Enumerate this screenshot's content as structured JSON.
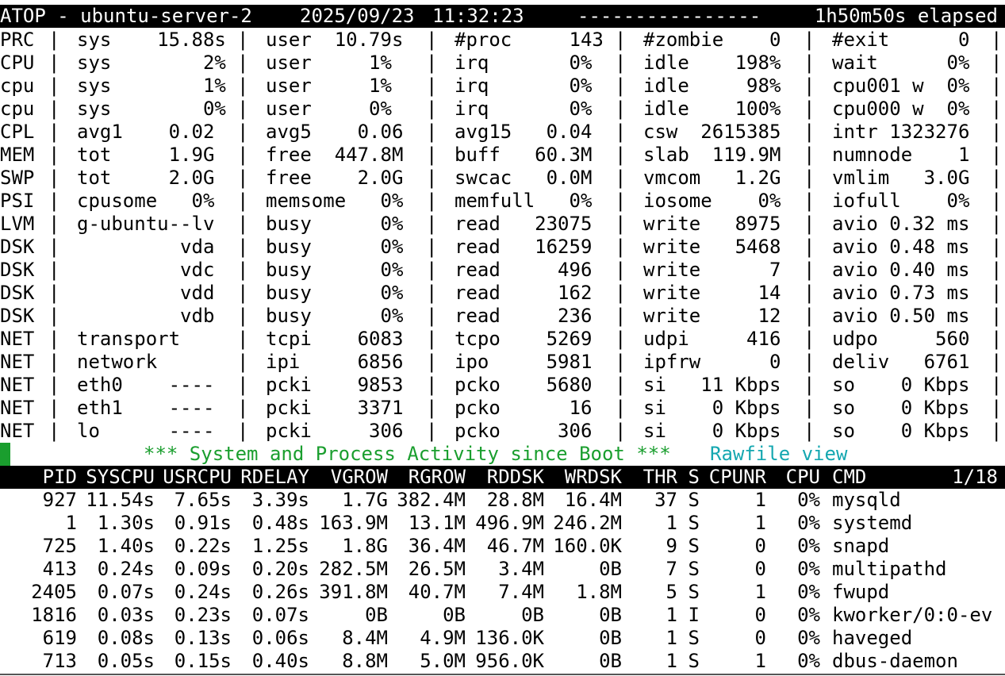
{
  "header": {
    "title": "ATOP - ubuntu-server-2",
    "date": "2025/09/23",
    "time": "11:32:23",
    "dashes": "----------------",
    "elapsed": "1h50m50s elapsed"
  },
  "stats": [
    {
      "label": "PRC",
      "c": [
        "sys    15.88s",
        "user  10.79s",
        "#proc     143",
        "#zombie    0",
        "#exit      0"
      ]
    },
    {
      "label": "CPU",
      "c": [
        "sys        2%",
        "user     1%",
        "irq       0%",
        "idle    198%",
        "wait      0%"
      ]
    },
    {
      "label": "cpu",
      "c": [
        "sys        1%",
        "user     1%",
        "irq       0%",
        "idle     98%",
        "cpu001 w  0%"
      ]
    },
    {
      "label": "cpu",
      "c": [
        "sys        0%",
        "user     0%",
        "irq       0%",
        "idle    100%",
        "cpu000 w  0%"
      ]
    },
    {
      "label": "CPL",
      "c": [
        "avg1    0.02",
        "avg5    0.06",
        "avg15   0.04",
        "csw  2615385",
        "intr 1323276"
      ]
    },
    {
      "label": "MEM",
      "c": [
        "tot     1.9G",
        "free  447.8M",
        "buff   60.3M",
        "slab  119.9M",
        "numnode    1"
      ]
    },
    {
      "label": "SWP",
      "c": [
        "tot     2.0G",
        "free    2.0G",
        "swcac   0.0M",
        "vmcom   1.2G",
        "vmlim   3.0G"
      ]
    },
    {
      "label": "PSI",
      "c": [
        "cpusome   0%",
        "memsome   0%",
        "memfull   0%",
        "iosome    0%",
        "iofull    0%"
      ]
    },
    {
      "label": "LVM",
      "c": [
        "g-ubuntu--lv",
        "busy      0%",
        "read   23075",
        "write   8975",
        "avio 0.32 ms"
      ]
    },
    {
      "label": "DSK",
      "c": [
        "         vda",
        "busy      0%",
        "read   16259",
        "write   5468",
        "avio 0.48 ms"
      ]
    },
    {
      "label": "DSK",
      "c": [
        "         vdc",
        "busy      0%",
        "read     496",
        "write      7",
        "avio 0.40 ms"
      ]
    },
    {
      "label": "DSK",
      "c": [
        "         vdd",
        "busy      0%",
        "read     162",
        "write     14",
        "avio 0.73 ms"
      ]
    },
    {
      "label": "DSK",
      "c": [
        "         vdb",
        "busy      0%",
        "read     236",
        "write     12",
        "avio 0.50 ms"
      ]
    },
    {
      "label": "NET",
      "c": [
        "transport   ",
        "tcpi    6083",
        "tcpo    5269",
        "udpi     416",
        "udpo     560"
      ]
    },
    {
      "label": "NET",
      "c": [
        "network     ",
        "ipi     6856",
        "ipo     5981",
        "ipfrw      0",
        "deliv   6761"
      ]
    },
    {
      "label": "NET",
      "c": [
        "eth0    ----",
        "pcki    9853",
        "pcko    5680",
        "si   11 Kbps",
        "so    0 Kbps"
      ]
    },
    {
      "label": "NET",
      "c": [
        "eth1    ----",
        "pcki    3371",
        "pcko      16",
        "si    0 Kbps",
        "so    0 Kbps"
      ]
    },
    {
      "label": "NET",
      "c": [
        "lo      ----",
        "pcki     306",
        "pcko     306",
        "si    0 Kbps",
        "so    0 Kbps"
      ]
    }
  ],
  "separator": "|",
  "banner": {
    "message": "*** System and Process Activity since Boot ***",
    "view": "Rawfile view"
  },
  "proc_header": {
    "columns": [
      "PID",
      "SYSCPU",
      "USRCPU",
      "RDELAY",
      "VGROW",
      "RGROW",
      "RDDSK",
      "WRDSK",
      "THR",
      "S",
      "CPUNR",
      "CPU",
      "CMD"
    ],
    "page": "1/18"
  },
  "processes": [
    [
      "927",
      "11.54s",
      "7.65s",
      "3.39s",
      "1.7G",
      "382.4M",
      "28.8M",
      "16.4M",
      "37",
      "S",
      "1",
      "0%",
      "mysqld"
    ],
    [
      "1",
      "1.30s",
      "0.91s",
      "0.48s",
      "163.9M",
      "13.1M",
      "496.9M",
      "246.2M",
      "1",
      "S",
      "1",
      "0%",
      "systemd"
    ],
    [
      "725",
      "1.40s",
      "0.22s",
      "1.25s",
      "1.8G",
      "36.4M",
      "46.7M",
      "160.0K",
      "9",
      "S",
      "0",
      "0%",
      "snapd"
    ],
    [
      "413",
      "0.24s",
      "0.09s",
      "0.20s",
      "282.5M",
      "26.5M",
      "3.4M",
      "0B",
      "7",
      "S",
      "0",
      "0%",
      "multipathd"
    ],
    [
      "2405",
      "0.07s",
      "0.24s",
      "0.26s",
      "391.8M",
      "40.7M",
      "7.4M",
      "1.8M",
      "5",
      "S",
      "1",
      "0%",
      "fwupd"
    ],
    [
      "1816",
      "0.03s",
      "0.23s",
      "0.07s",
      "0B",
      "0B",
      "0B",
      "0B",
      "1",
      "I",
      "0",
      "0%",
      "kworker/0:0-ev"
    ],
    [
      "619",
      "0.08s",
      "0.13s",
      "0.06s",
      "8.4M",
      "4.9M",
      "136.0K",
      "0B",
      "1",
      "S",
      "0",
      "0%",
      "haveged"
    ],
    [
      "713",
      "0.05s",
      "0.15s",
      "0.40s",
      "8.8M",
      "5.0M",
      "956.0K",
      "0B",
      "1",
      "S",
      "1",
      "0%",
      "dbus-daemon"
    ]
  ],
  "colors": {
    "background": "#ffffff",
    "foreground": "#000000",
    "bar": "#000000",
    "bar_text": "#ffffff",
    "green": "#1a9e2e",
    "cyan": "#14a7b0"
  }
}
